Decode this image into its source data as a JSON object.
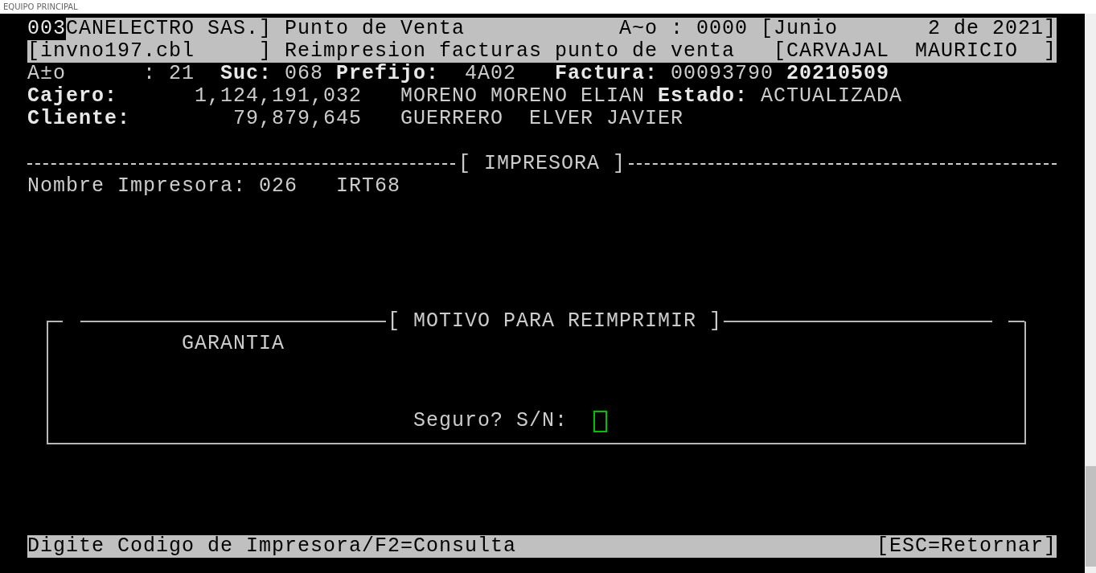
{
  "window": {
    "title": "EQUIPO PRINCIPAL"
  },
  "header": {
    "line_1": {
      "code": "003",
      "company": "CANELECTRO SAS.]",
      "module": "Punto de Venta",
      "year": "A~o : 0000",
      "month": "[Junio",
      "date": "2 de 2021]"
    },
    "line_2": {
      "program": "[invno197.cbl",
      "program_end": "]",
      "title": "Reimpresion facturas punto de venta",
      "user": "[CARVAJAL  MAURICIO",
      "user_end": "]"
    }
  },
  "invoice": {
    "year_label": "A±o",
    "year_value": ": 21",
    "branch_label": "Suc:",
    "branch_value": "068",
    "prefix_label": "Prefijo:",
    "prefix_value": "4A02",
    "invoice_label": "Factura:",
    "invoice_number": "00093790",
    "invoice_date": "20210509",
    "cashier_label": "Cajero:",
    "cashier_id": "1,124,191,032",
    "cashier_name": "MORENO MORENO ELIAN",
    "status_label": "Estado:",
    "status_value": "ACTUALIZADA",
    "client_label": "Cliente:",
    "client_id": "79,879,645",
    "client_name": "GUERRERO  ELVER JAVIER"
  },
  "printer_section": {
    "title": "[ IMPRESORA ]",
    "label": "Nombre Impresora:",
    "code": "026",
    "name": "IRT68"
  },
  "dialog": {
    "title": "[ MOTIVO PARA REIMPRIMIR ]",
    "reason": "GARANTIA",
    "prompt": "Seguro? S/N:"
  },
  "status_bar": {
    "hint": "Digite Codigo de Impresora/F2=Consulta",
    "escape": "[ESC=Retornar]"
  }
}
